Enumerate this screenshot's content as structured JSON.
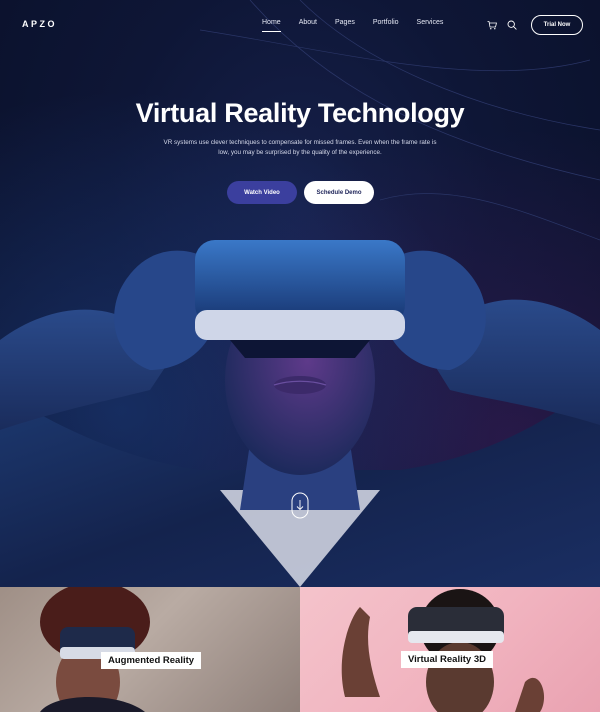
{
  "brand": {
    "logo": "APZO"
  },
  "nav": {
    "items": [
      {
        "label": "Home",
        "active": true
      },
      {
        "label": "About",
        "active": false
      },
      {
        "label": "Pages",
        "active": false
      },
      {
        "label": "Portfolio",
        "active": false
      },
      {
        "label": "Services",
        "active": false
      }
    ],
    "icons": [
      "cart-icon",
      "search-icon"
    ],
    "cta_label": "Trial Now"
  },
  "hero": {
    "title": "Virtual Reality Technology",
    "description_line1": "VR systems use clever techniques to compensate for missed frames. Even when the frame rate is",
    "description_line2": "low, you may be surprised by the quality of the experience.",
    "primary_button": "Watch Video",
    "secondary_button": "Schedule Demo",
    "scroll_icon": "scroll-down-icon"
  },
  "cards": [
    {
      "label": "Augmented Reality"
    },
    {
      "label": "Virtual Reality 3D"
    }
  ],
  "colors": {
    "background": "#0d1535",
    "primary_button": "#3b3f9e",
    "secondary_button_text": "#1d2358",
    "card_left": "#a89890",
    "card_right": "#f2b8c3"
  }
}
